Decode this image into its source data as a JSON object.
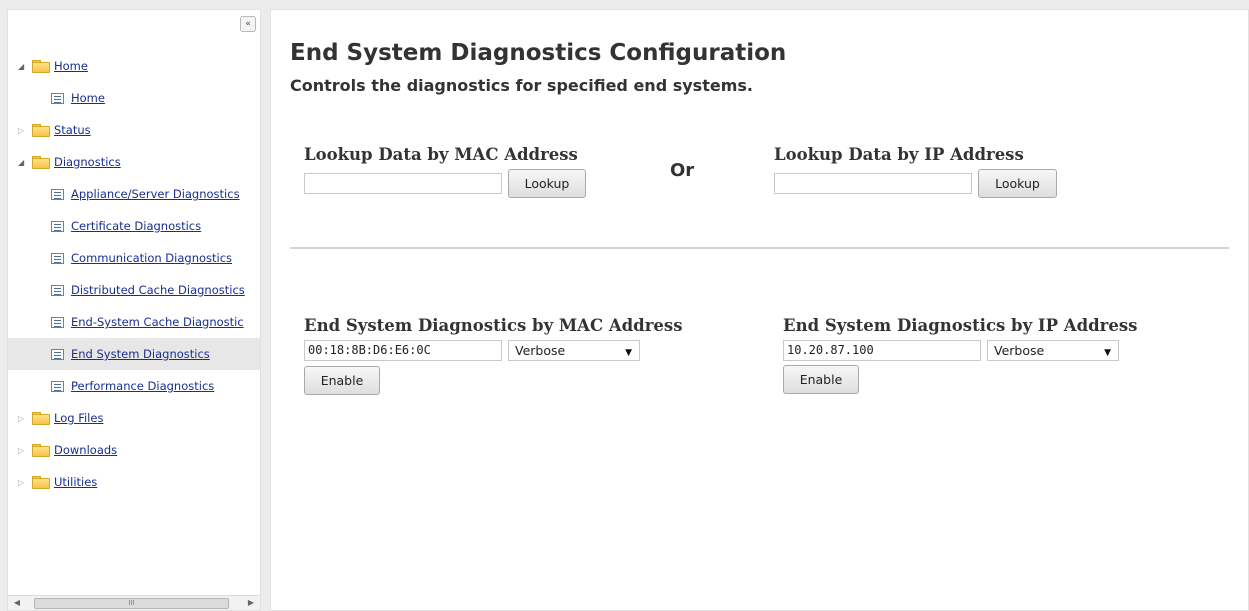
{
  "sidebar": {
    "collapse_label": "«",
    "tree": [
      {
        "label": "Home",
        "type": "folder",
        "expanded": true,
        "icon": "folder-icon"
      },
      {
        "label": "Home",
        "type": "page",
        "icon": "page-icon"
      },
      {
        "label": "Status",
        "type": "folder",
        "expanded": false,
        "icon": "folder-icon"
      },
      {
        "label": "Diagnostics",
        "type": "folder",
        "expanded": true,
        "icon": "folder-icon"
      },
      {
        "label": "Appliance/Server Diagnostics",
        "type": "page",
        "icon": "page-icon"
      },
      {
        "label": "Certificate Diagnostics",
        "type": "page",
        "icon": "page-icon"
      },
      {
        "label": "Communication Diagnostics",
        "type": "page",
        "icon": "page-icon"
      },
      {
        "label": "Distributed Cache Diagnostics",
        "type": "page",
        "icon": "page-icon"
      },
      {
        "label": "End-System Cache Diagnostic",
        "type": "page",
        "icon": "page-icon"
      },
      {
        "label": "End System Diagnostics",
        "type": "page",
        "icon": "page-icon",
        "selected": true
      },
      {
        "label": "Performance Diagnostics",
        "type": "page",
        "icon": "page-icon"
      },
      {
        "label": "Log Files",
        "type": "folder",
        "expanded": false,
        "icon": "folder-icon"
      },
      {
        "label": "Downloads",
        "type": "folder",
        "expanded": false,
        "icon": "folder-icon"
      },
      {
        "label": "Utilities",
        "type": "folder",
        "expanded": false,
        "icon": "folder-icon"
      }
    ],
    "scrollbar": {
      "thumb_grip": "III"
    }
  },
  "main": {
    "title": "End System Diagnostics Configuration",
    "subtitle": "Controls the diagnostics for specified end systems.",
    "lookup": {
      "mac_label": "Lookup Data by MAC Address",
      "mac_value": "",
      "mac_button": "Lookup",
      "or_label": "Or",
      "ip_label": "Lookup Data by IP Address",
      "ip_value": "",
      "ip_button": "Lookup"
    },
    "diagnostics": {
      "mac_label": "End System Diagnostics by MAC Address",
      "mac_value": "00:18:8B:D6:E6:0C",
      "mac_level": "Verbose",
      "mac_button": "Enable",
      "ip_label": "End System Diagnostics by IP Address",
      "ip_value": "10.20.87.100",
      "ip_level": "Verbose",
      "ip_button": "Enable"
    }
  }
}
